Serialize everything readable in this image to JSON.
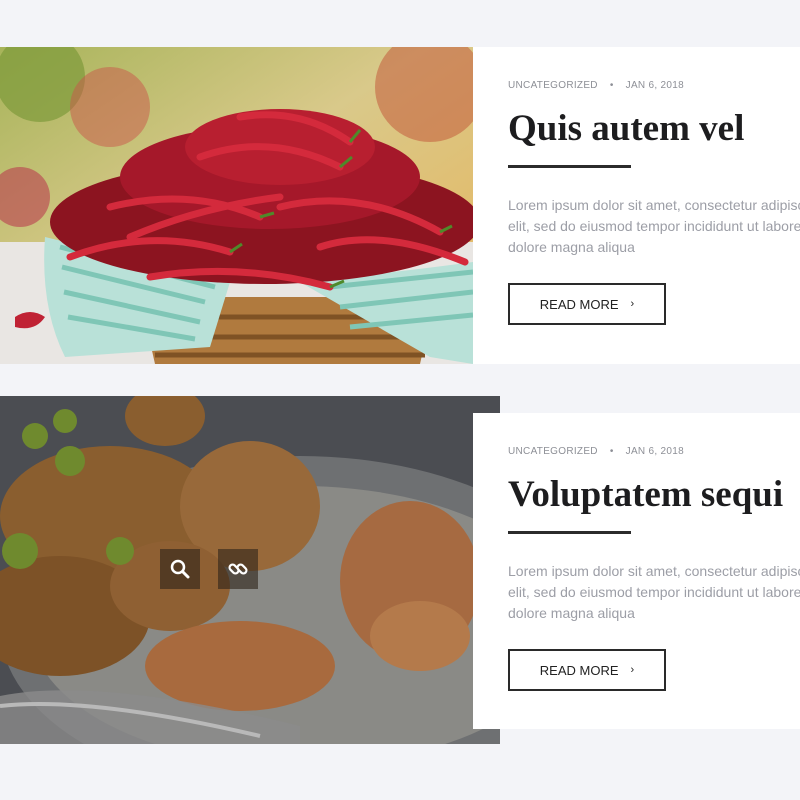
{
  "colors": {
    "page_bg": "#f3f4f8",
    "card_bg": "#ffffff",
    "title": "#1d1d1f",
    "meta": "#8d8f96",
    "excerpt": "#9c9ea6"
  },
  "posts": [
    {
      "image": "red chili peppers in a wicker basket",
      "category": "UNCATEGORIZED",
      "separator": "•",
      "date": "JAN 6, 2018",
      "title": "Quis autem vel",
      "excerpt": "Lorem ipsum dolor sit amet, consectetur adipiscing elit, sed do eiusmod tempor incididunt ut labore et dolore magna aliqua",
      "read_more": "READ MORE",
      "read_more_icon": "chevron-right-icon"
    },
    {
      "image": "fried shrimp and scallops on a plate (dimmed hover state)",
      "category": "UNCATEGORIZED",
      "separator": "•",
      "date": "JAN 6, 2018",
      "title": "Voluptatem sequi",
      "excerpt": "Lorem ipsum dolor sit amet, consectetur adipiscing elit, sed do eiusmod tempor incididunt ut labore et dolore magna aliqua",
      "read_more": "READ MORE",
      "read_more_icon": "chevron-right-icon",
      "overlay_icons": [
        "search-icon",
        "link-icon"
      ]
    }
  ]
}
